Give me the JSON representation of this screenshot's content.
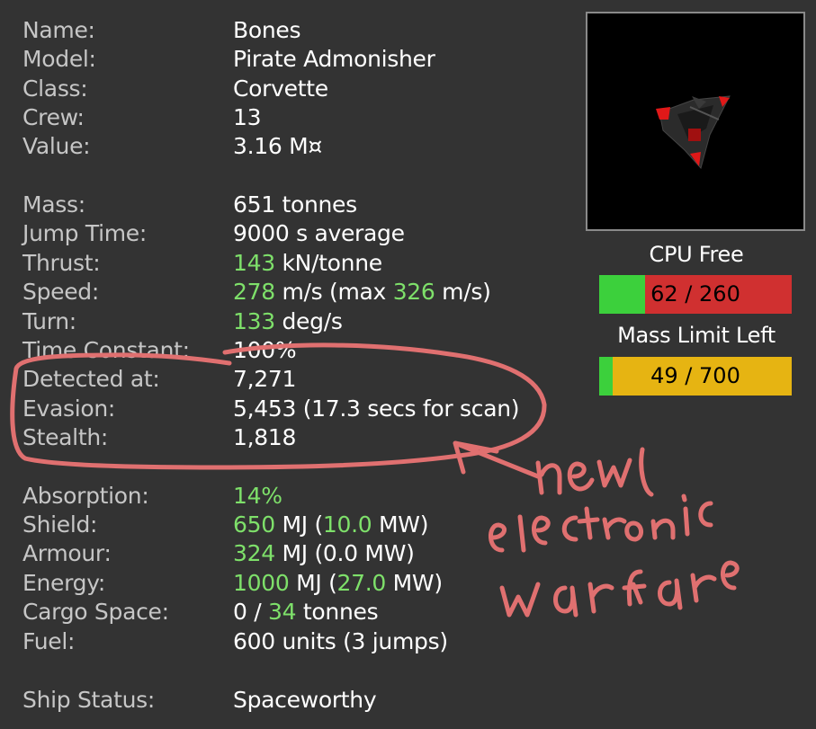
{
  "ship": {
    "rows": [
      {
        "label": "Name:",
        "value": "Bones"
      },
      {
        "label": "Model:",
        "value": "Pirate Admonisher"
      },
      {
        "label": "Class:",
        "value": "Corvette"
      },
      {
        "label": "Crew:",
        "value": "13"
      },
      {
        "label": "Value:",
        "value": "3.16 M¤"
      },
      {
        "label": "Mass:",
        "value": "651 tonnes"
      },
      {
        "label": "Jump Time:",
        "value": "9000 s average"
      },
      {
        "label": "Thrust:",
        "v1": "143",
        "v2": " kN/tonne"
      },
      {
        "label": "Speed:",
        "v1": "278",
        "v2": " m/s (max ",
        "v3": "326",
        "v4": " m/s)"
      },
      {
        "label": "Turn:",
        "v1": "133",
        "v2": " deg/s"
      },
      {
        "label": "Time Constant:",
        "value": "100%"
      },
      {
        "label": "Detected at:",
        "value": "7,271"
      },
      {
        "label": "Evasion:",
        "value": "5,453 (17.3 secs for scan)"
      },
      {
        "label": "Stealth:",
        "value": "1,818"
      },
      {
        "label": "Absorption:",
        "v1": "14%"
      },
      {
        "label": "Shield:",
        "v1": "650",
        "v2": " MJ (",
        "v3": "10.0",
        "v4": " MW)"
      },
      {
        "label": "Armour:",
        "v1": "324",
        "v2": " MJ (0.0 MW)"
      },
      {
        "label": "Energy:",
        "v1": "1000",
        "v2": " MJ (",
        "v3": "27.0",
        "v4": " MW)"
      },
      {
        "label": "Cargo Space:",
        "v1": "0 / ",
        "v2": "34",
        "v3": " tonnes"
      },
      {
        "label": "Fuel:",
        "value": "600 units (3 jumps)"
      },
      {
        "label": "Ship Status:",
        "value": "Spaceworthy"
      }
    ]
  },
  "cpu": {
    "title": "CPU Free",
    "text": "62 / 260",
    "free": 62,
    "total": 260
  },
  "mass_limit": {
    "title": "Mass Limit Left",
    "text": "49 / 700",
    "free": 49,
    "total": 700
  },
  "annotation": {
    "text": "new electronic warfare",
    "color": "#e07070"
  },
  "colors": {
    "highlight": "#7ee06a",
    "bar_green": "#3cd03c",
    "cpu_red": "#d03030",
    "mass_yellow": "#e6b412"
  }
}
